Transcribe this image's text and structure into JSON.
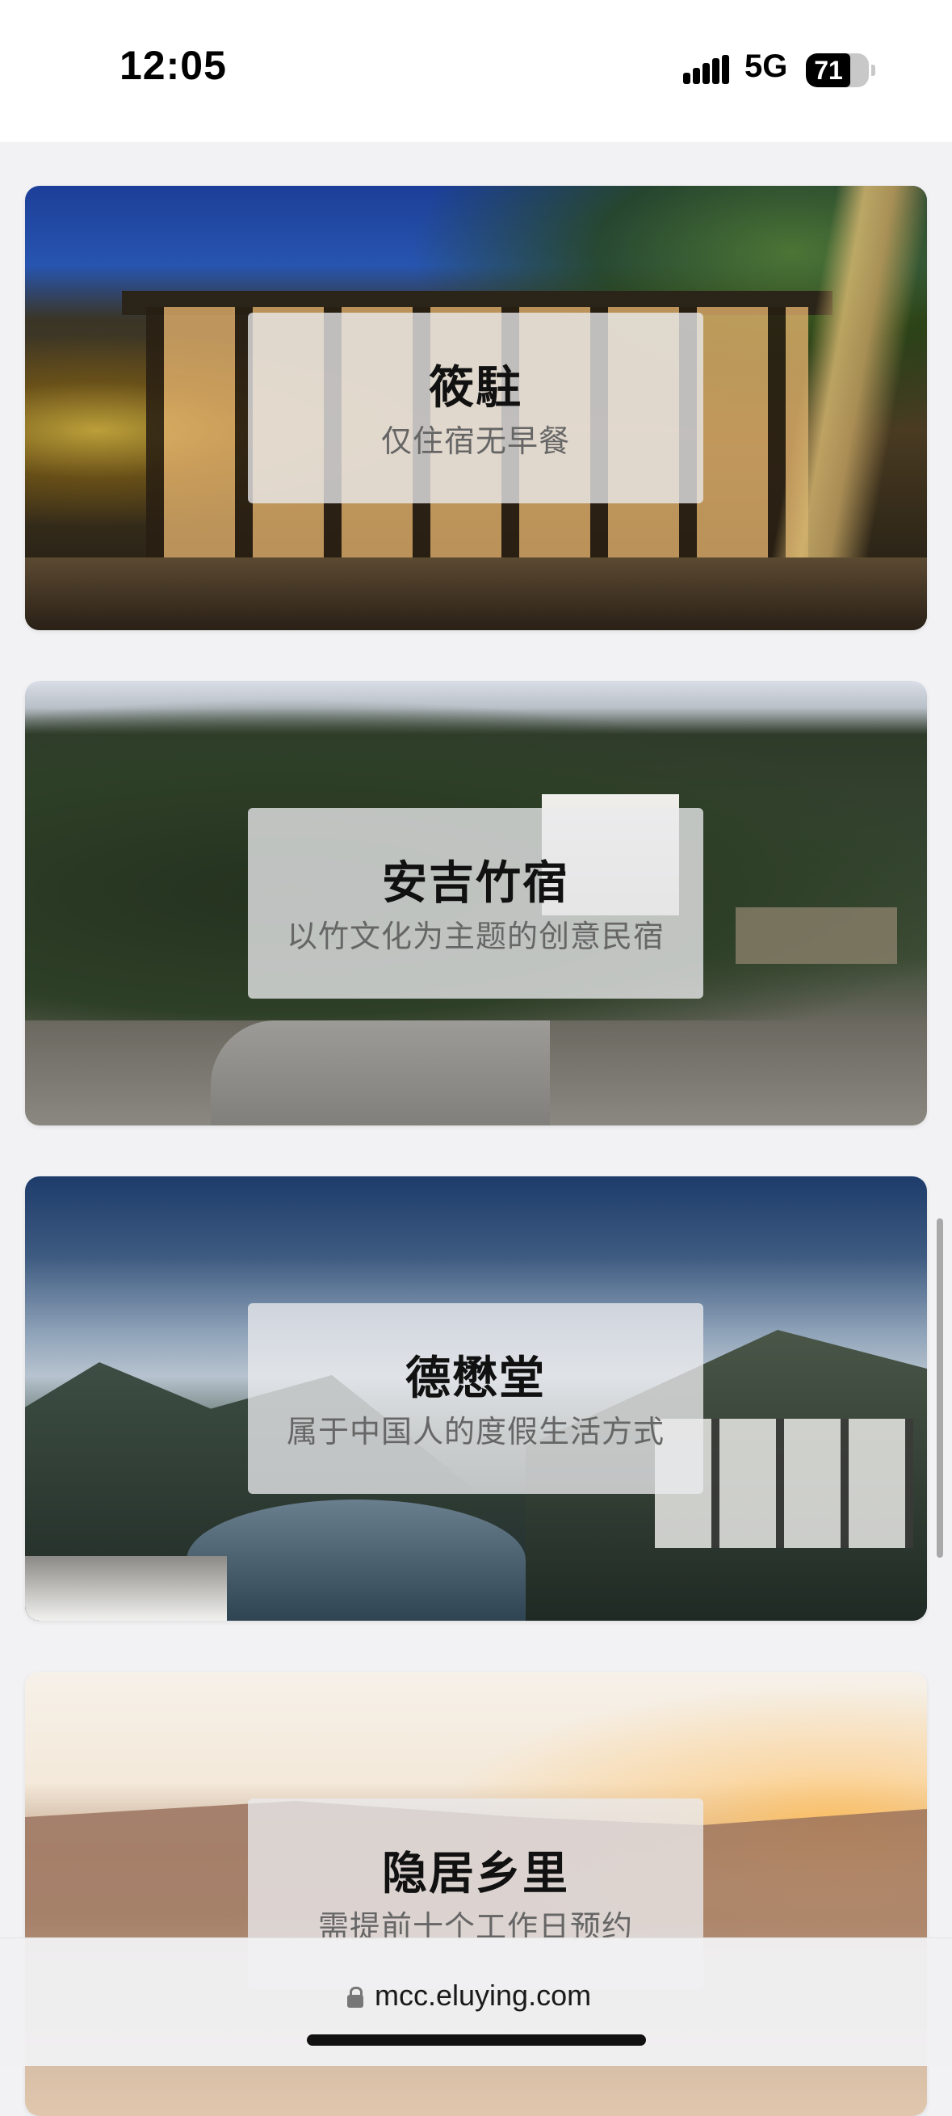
{
  "status_bar": {
    "time": "12:05",
    "network": "5G",
    "battery_percent": "71",
    "battery_level": 0.71,
    "signal_icon": "cellular-signal-icon"
  },
  "cards": [
    {
      "title": "筱駐",
      "subtitle": "仅住宿无早餐"
    },
    {
      "title": "安吉竹宿",
      "subtitle": "以竹文化为主题的创意民宿"
    },
    {
      "title": "德懋堂",
      "subtitle": "属于中国人的度假生活方式"
    },
    {
      "title": "隐居乡里",
      "subtitle": "需提前十个工作日预约"
    }
  ],
  "url_bar": {
    "url": "mcc.eluying.com",
    "icon": "lock-icon"
  },
  "colors": {
    "page_background": "#f2f2f4",
    "overlay": "#ebebed",
    "title": "#111111",
    "subtitle": "#666666"
  }
}
